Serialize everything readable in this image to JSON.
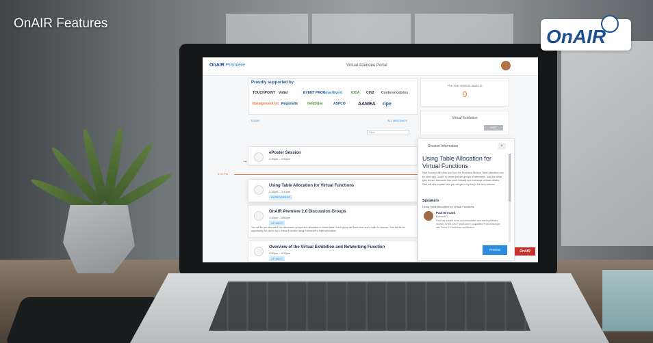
{
  "video": {
    "title": "OnAIR Features",
    "brand_logo_text": "OnAIR"
  },
  "app": {
    "logo": "OnAIR",
    "logo_suffix": "Premiere",
    "portal_title": "Virtual Attendee Portal",
    "corner_logo": "OnAIR"
  },
  "sponsors": {
    "title": "Proudly supported by",
    "logos": [
      "TOUCHPOINT",
      "Vidtel",
      "EVENT PROG",
      "smartEvent",
      "IODA",
      "CINZ",
      "Conferencebites",
      "Management Inc",
      "Regonsite",
      "fieldDrive",
      "ASPCO",
      "AAMEA",
      "ripe"
    ]
  },
  "tabs": {
    "today": "TODAY",
    "all": "ALL MEETINGS"
  },
  "search": {
    "placeholder": "Filter"
  },
  "now_label": "3:26 PM",
  "sessions": [
    {
      "title": "ePoster Session",
      "time": "2:30pm – 2:55pm",
      "tag": "",
      "desc": ""
    },
    {
      "title": "Using Table Allocation for Virtual Functions",
      "time": "2:35pm – 3:40pm",
      "tag": "IN PROGRESS",
      "desc": ""
    },
    {
      "title": "OnAIR Premiere 2.0 Discussion Groups",
      "time": "3:40pm – 3:55pm",
      "tag": "UP NEXT",
      "desc": "You will be pre-allocated into discussion groups and allocation is virtual table. Each group will have host and a topic to discuss. This will be an opportunity for you to try a Virtual Function using EventsAIR's Table Allocation."
    },
    {
      "title": "Overview of the Virtual Exhibition and Networking Function",
      "time": "4:00pm – 4:20pm",
      "tag": "UP NEXT",
      "desc": ""
    }
  ],
  "next_session": {
    "label": "The next session starts in",
    "value": "0"
  },
  "virtual_exhibition": {
    "label": "Virtual Exhibition",
    "button": "VISIT"
  },
  "info_panel": {
    "header": "Session Information",
    "close": "×",
    "title": "Using Table Allocation for Virtual Functions",
    "body": "Paul Brouard will show you how the Functions Module Table Allocation can be used with OnAIR to create pre-set groups of attendees. Just like a live gala dinner, attendees can meet virtually and exchange contact details. Paul will also explain how you will get to try this in the next session.",
    "speakers_label": "Speakers",
    "session_sub": "Using Table Allocation for Virtual Functions",
    "speaker_name": "Paul Brouard",
    "speaker_org": "EventsAIR",
    "speaker_bio": "Paul has worked in the accommodation and events software industry for the past 7 years and is a qualified Project Manager with Prince 2 Practitioner certification.",
    "button": "Preview"
  }
}
